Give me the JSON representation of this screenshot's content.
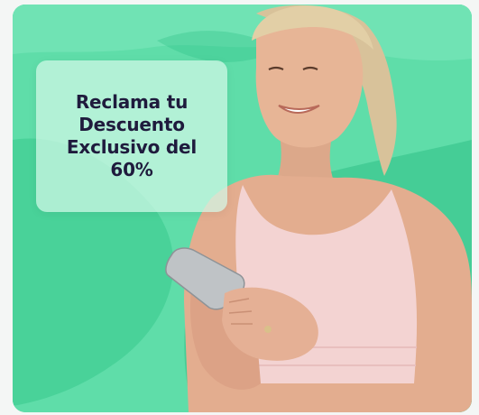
{
  "promo": {
    "headline": "Reclama tu Descuento Exclusivo del 60%"
  },
  "colors": {
    "card_background": "#5fdda9",
    "accent_dark": "#2fbf86",
    "accent_light": "#7ee8bd",
    "headline_text": "#1f1b3d",
    "top_color": "#f3d3d2",
    "skin": "#e7b596"
  },
  "image": {
    "subject": "smiling-woman-holding-phone"
  }
}
